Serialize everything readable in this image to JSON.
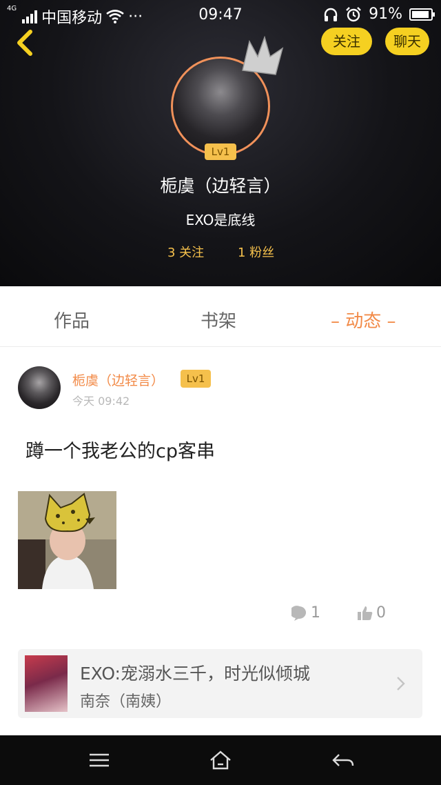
{
  "status_bar": {
    "network_badge": "4G",
    "carrier": "中国移动",
    "extra": "···",
    "time": "09:47",
    "battery": "91%",
    "battery_level": 0.91
  },
  "header": {
    "follow_button": "关注",
    "chat_button": "聊天",
    "level": "Lv1",
    "name": "栀虞（边轻言）",
    "signature": "EXO是底线",
    "following": "3 关注",
    "fans": "1 粉丝"
  },
  "tabs": [
    {
      "label": "作品",
      "active": false
    },
    {
      "label": "书架",
      "active": false
    },
    {
      "label": "– 动态 –",
      "active": true
    }
  ],
  "post": {
    "author": "栀虞（边轻言）",
    "level": "Lv1",
    "time": "今天 09:42",
    "text": "蹲一个我老公的cp客串",
    "comments": "1",
    "likes": "0"
  },
  "book_card": {
    "title": "EXO:宠溺水三千，时光似倾城",
    "author": "南奈（南姨）"
  },
  "colors": {
    "accent_orange": "#f28a47",
    "button_yellow": "#f5d021",
    "level_badge": "#f5c04c"
  }
}
